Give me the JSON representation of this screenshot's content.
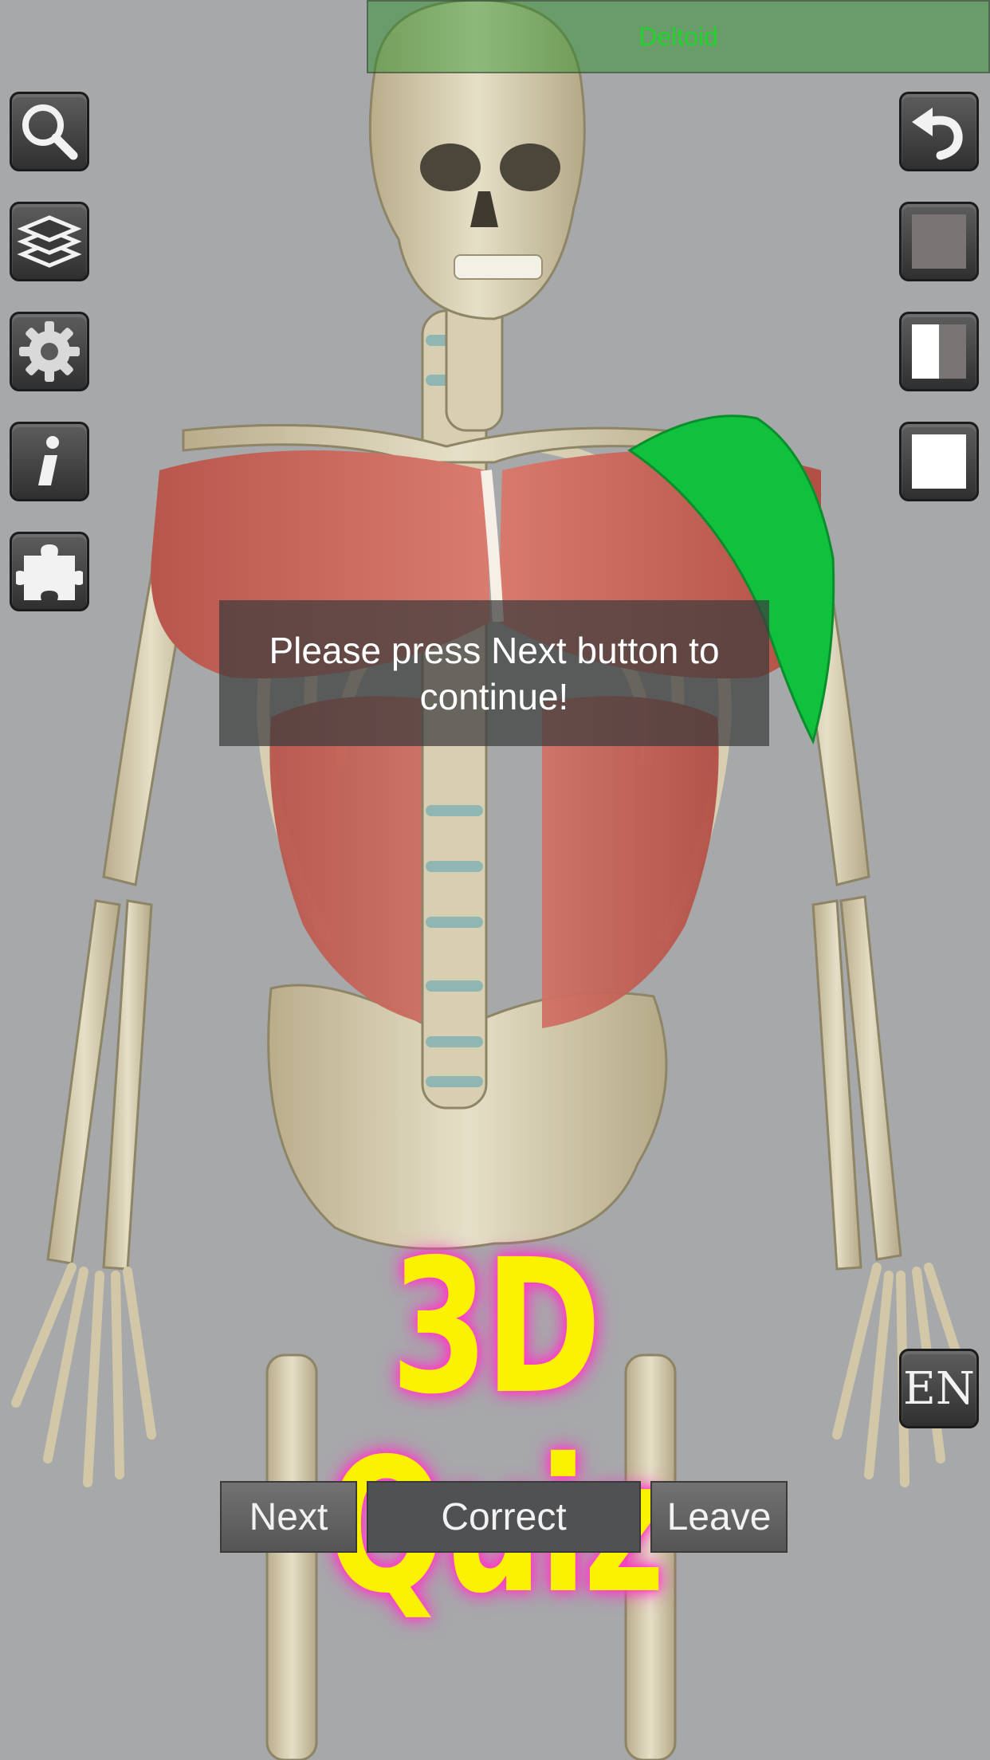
{
  "app": {
    "selected_structure": "Deltoid",
    "message": "Please press Next button to continue!",
    "title": "3D Quiz",
    "language": "EN"
  },
  "left_toolbar": {
    "items": [
      {
        "icon": "search-icon"
      },
      {
        "icon": "layers-icon"
      },
      {
        "icon": "gear-icon"
      },
      {
        "icon": "info-icon"
      },
      {
        "icon": "puzzle-icon"
      }
    ]
  },
  "right_toolbar": {
    "items": [
      {
        "icon": "undo-icon"
      },
      {
        "icon": "opacity-full-icon"
      },
      {
        "icon": "opacity-half-icon"
      },
      {
        "icon": "opacity-none-icon"
      }
    ]
  },
  "quiz_controls": {
    "next_label": "Next",
    "correct_label": "Correct",
    "leave_label": "Leave"
  },
  "colors": {
    "background": "#a7a8aa",
    "highlight_muscle": "#10c13d",
    "title_fill": "#fbf200",
    "title_glow": "#ff37c7",
    "banner_text": "#21d32b"
  }
}
